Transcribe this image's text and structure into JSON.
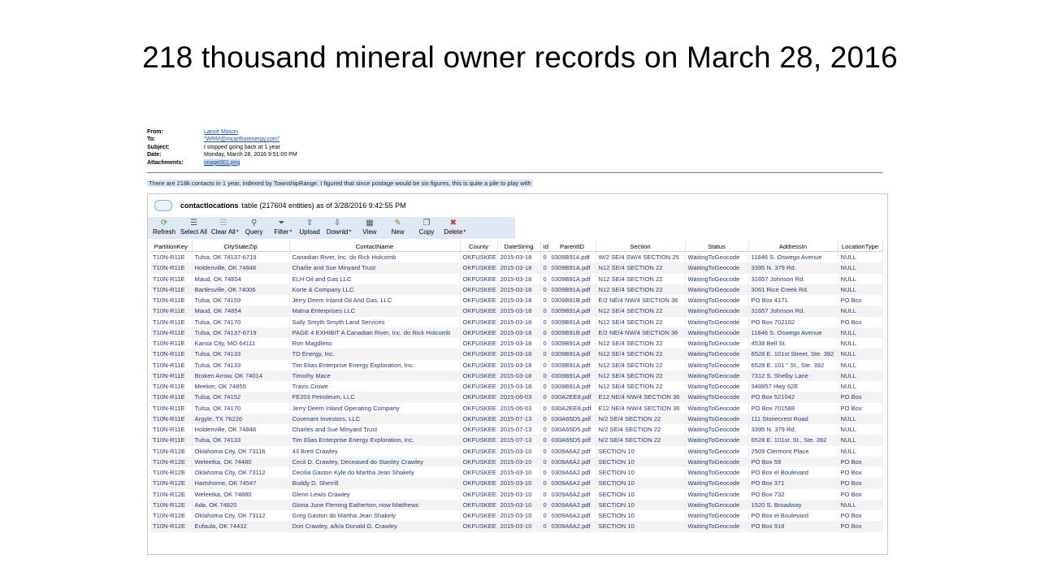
{
  "slide_title": "218 thousand mineral owner records on March 28, 2016",
  "email": {
    "from_label": "From:",
    "from_value": "Lance Mason",
    "to_label": "To:",
    "to_value": "\"WRM@mcarthurenergy.com\"",
    "subject_label": "Subject:",
    "subject_value": "I stopped going back at 1 year",
    "date_label": "Date:",
    "date_value": "Monday, March 28, 2016 9:51:00 PM",
    "attachments_label": "Attachments:",
    "attachments_value": "image001.png",
    "body_line": "There are 218k contacts in 1 year, indexed by TownshipRange.  I figured that since postage would be six figures, this is quite a pile to play with"
  },
  "table_header": {
    "name": "contactlocations",
    "rest": "table  (217604 entities) as of 3/28/2016 9:42:55 PM"
  },
  "toolbar": {
    "refresh": "Refresh",
    "select_all": "Select All",
    "clear_all": "Clear All",
    "query": "Query",
    "filter": "Filter",
    "upload": "Upload",
    "download": "Downld",
    "view": "View",
    "new": "New",
    "copy": "Copy",
    "delete": "Delete"
  },
  "columns": [
    "PartitionKey",
    "CityStateZip",
    "ContactName",
    "County",
    "DateString",
    "Id",
    "ParentID",
    "Section",
    "Status",
    "AddressIn",
    "LocationType"
  ],
  "rows": [
    [
      "T10N-R11E",
      "Tulsa, OK 74137-6719",
      "Canadian River, Inc. do Rick Holcomb",
      "OKFUSKEE",
      "2015-03-18",
      "0",
      "0309B914.pdf",
      "W/2 SE/4 SW/4 SECTION 25",
      "WaitingToGeocode",
      "11846 S. Oswego Avenue",
      "NULL"
    ],
    [
      "T10N-R11E",
      "Holdenville, OK 74848",
      "Charlie and Sue Minyard Trust",
      "OKFUSKEE",
      "2015-03-18",
      "0",
      "0309B91A.pdf",
      "N12 SE/4 SECTION 22",
      "WaitingToGeocode",
      "3395 N. 379 Rd.",
      "NULL"
    ],
    [
      "T10N-R11E",
      "Maud, OK 74854",
      "ELH Oil and Gas LLC",
      "OKFUSKEE",
      "2015-03-18",
      "0",
      "0309B91A.pdf",
      "N12 SE/4 SECTION 22",
      "WaitingToGeocode",
      "31657 Johnson Rd.",
      "NULL"
    ],
    [
      "T10N-R11E",
      "Bartlesville, OK 74006",
      "Korte & Company LLC",
      "OKFUSKEE",
      "2015-03-18",
      "0",
      "0309B91A.pdf",
      "N12 SE/4 SECTION 22",
      "WaitingToGeocode",
      "3061 Rice Creek Rd.",
      "NULL"
    ],
    [
      "T10N-R11E",
      "Tulsa, OK 74159",
      "Jerry Deem Inland Oil And Gas, LLC",
      "OKFUSKEE",
      "2015-03-18",
      "0",
      "0309B91B.pdf",
      "E/2 NE/4 NW/4 SECTION 36",
      "WaitingToGeocode",
      "PO Box 4171",
      "PO Box"
    ],
    [
      "T10N-R11E",
      "Maud, OK 74854",
      "Matna Enterprises LLC",
      "OKFUSKEE",
      "2015-03-18",
      "0",
      "0309B91A.pdf",
      "N12 SE/4 SECTION 22",
      "WaitingToGeocode",
      "31657 Johnson Rd.",
      "NULL"
    ],
    [
      "T10N-R11E",
      "Tulsa, OK 74170",
      "Sally Smyth Smyth Land Services",
      "OKFUSKEE",
      "2015-03-18",
      "0",
      "0309B91A.pdf",
      "N12 SE/4 SECTION 22",
      "WaitingToGeocode",
      "PO Box 702102",
      "PO Box"
    ],
    [
      "T10N-R11E",
      "Tulsa, OK 74137-6719",
      "PAGE 4 EXHIBIT A Canadian River, Inc. do Rick Holcomb",
      "OKFUSKEE",
      "2015-03-18",
      "0",
      "0309B91B.pdf",
      "E/2 NE/4 NW/4 SECTION 36",
      "WaitingToGeocode",
      "11846 S. Oswego Avenue",
      "NULL"
    ],
    [
      "T10N-R11E",
      "Kansa City, MO 64111",
      "Ron Magdleno",
      "OKFUSKEE",
      "2015-03-18",
      "0",
      "0309B91A.pdf",
      "N12 SE/4 SECTION 22",
      "WaitingToGeocode",
      "4538 Bell St.",
      "NULL"
    ],
    [
      "T10N-R11E",
      "Tulsa, OK 74133",
      "TD Energy, Inc.",
      "OKFUSKEE",
      "2015-03-18",
      "0",
      "0309B91A.pdf",
      "N12 SE/4 SECTION 22",
      "WaitingToGeocode",
      "6528 E. 101st Street, Ste. 392",
      "NULL"
    ],
    [
      "T10N-R11E",
      "Tulsa, OK 74133",
      "Tim Elias Enterprise Energy Exploration, Inc.",
      "OKFUSKEE",
      "2015-03-18",
      "0",
      "0309B91A.pdf",
      "N12 SE/4 SECTION 22",
      "WaitingToGeocode",
      "6528 E. 101 \" St., Ste. 392",
      "NULL"
    ],
    [
      "T10N-R11E",
      "Broken Arrow, OK 74014",
      "Timothy Mace",
      "OKFUSKEE",
      "2015-03-18",
      "0",
      "0309B91A.pdf",
      "N12 SE/4 SECTION 22",
      "WaitingToGeocode",
      "7312 S. Shelby Lane",
      "NULL"
    ],
    [
      "T10N-R11E",
      "Meeker, OK 74855",
      "Travis Crowe",
      "OKFUSKEE",
      "2015-03-18",
      "0",
      "0309B91A.pdf",
      "N12 SE/4 SECTION 22",
      "WaitingToGeocode",
      "348857 Hwy 62E",
      "NULL"
    ],
    [
      "T10N-R11E",
      "Tulsa, OK 74152",
      "FE203 Petroleum, LLC",
      "OKFUSKEE",
      "2015-06-03",
      "0",
      "030A2EE8.pdf",
      "E12 NE/4 NW/4 SECTION 36",
      "WaitingToGeocode",
      "PO Box 521042",
      "PO Box"
    ],
    [
      "T10N-R11E",
      "Tulsa, OK 74170",
      "Jerry Deem Inland Operating Company",
      "OKFUSKEE",
      "2015-06-03",
      "0",
      "030A2EE8.pdf",
      "E12 NE/4 NW/4 SECTION 36",
      "WaitingToGeocode",
      "PO Box 701588",
      "PO Box"
    ],
    [
      "T10N-R11E",
      "Argyle, TX 76226",
      "Covenant Investors, LLC",
      "OKFUSKEE",
      "2015-07-13",
      "0",
      "030A65D5.pdf",
      "N/2 SE/4 SECTION 22",
      "WaitingToGeocode",
      "111 Stonecrest Road",
      "NULL"
    ],
    [
      "T10N-R11E",
      "Holdenville, OK 74848",
      "Charles and Sue Minyard Trust",
      "OKFUSKEE",
      "2015-07-13",
      "0",
      "030A65D5.pdf",
      "N/2 SE/4 SECTION 22",
      "WaitingToGeocode",
      "3395 N. 379 Rd.",
      "NULL"
    ],
    [
      "T10N-R11E",
      "Tulsa, OK 74133",
      "Tim Elias Enterprise Energy Exploration, Inc.",
      "OKFUSKEE",
      "2015-07-13",
      "0",
      "030A65D5.pdf",
      "N/2 SE/4 SECTION 22",
      "WaitingToGeocode",
      "6528 E. 101st. St., Ste. 392",
      "NULL"
    ],
    [
      "T10N-R12E",
      "Oklahoma City, OK 73116",
      "43  Brett Crawley",
      "OKFUSKEE",
      "2015-03-10",
      "0",
      "0309A6A2.pdf",
      "SECTION 10",
      "WaitingToGeocode",
      "2509 Clermont Place",
      "NULL"
    ],
    [
      "T10N-R12E",
      "Weleetka, OK 74480",
      "Cecil D. Crawley, Deceased do Stanley Crawley",
      "OKFUSKEE",
      "2015-03-10",
      "0",
      "0309A6A2.pdf",
      "SECTION 10",
      "WaitingToGeocode",
      "PO Box 59",
      "PO Box"
    ],
    [
      "T10N-R12E",
      "Oklahoma City, OK 73112",
      "Cecilia Gaston Kyle do Martha Jean Shakely",
      "OKFUSKEE",
      "2015-03-10",
      "0",
      "0309A6A2.pdf",
      "SECTION 10",
      "WaitingToGeocode",
      "PO Box el Boulevard",
      "PO Box"
    ],
    [
      "T10N-R12E",
      "Hartshorne, OK 74547",
      "Buddy D. Sherrill",
      "OKFUSKEE",
      "2015-03-10",
      "0",
      "0309A6A2.pdf",
      "SECTION 10",
      "WaitingToGeocode",
      "PO Box 371",
      "PO Box"
    ],
    [
      "T10N-R12E",
      "Weleetka, OK 74880",
      "Glenn Lewis Crawley",
      "OKFUSKEE",
      "2015-03-10",
      "0",
      "0309A6A2.pdf",
      "SECTION 10",
      "WaitingToGeocode",
      "PO Box 732",
      "PO Box"
    ],
    [
      "T10N-R12E",
      "Ada, OK 74820",
      "Gloria June Fleming Eatherton, now Matthews",
      "OKFUSKEE",
      "2015-03-10",
      "0",
      "0309A6A2.pdf",
      "SECTION 10",
      "WaitingToGeocode",
      "1520 S. Broadway",
      "NULL"
    ],
    [
      "T10N-R12E",
      "Oklahoma City, OK 73112",
      "Greg Gaston do Martha Jean Shakely",
      "OKFUSKEE",
      "2015-03-10",
      "0",
      "0309A6A2.pdf",
      "SECTION 10",
      "WaitingToGeocode",
      "PO Box el Boulevard",
      "PO Box"
    ],
    [
      "T10N-R12E",
      "Eufaula, OK 74432",
      "Don Crawley, a/k/a Donald G. Crawley",
      "OKFUSKEE",
      "2015-03-10",
      "0",
      "0309A6A2.pdf",
      "SECTION 10",
      "WaitingToGeocode",
      "PO Box 918",
      "PO Box"
    ]
  ]
}
